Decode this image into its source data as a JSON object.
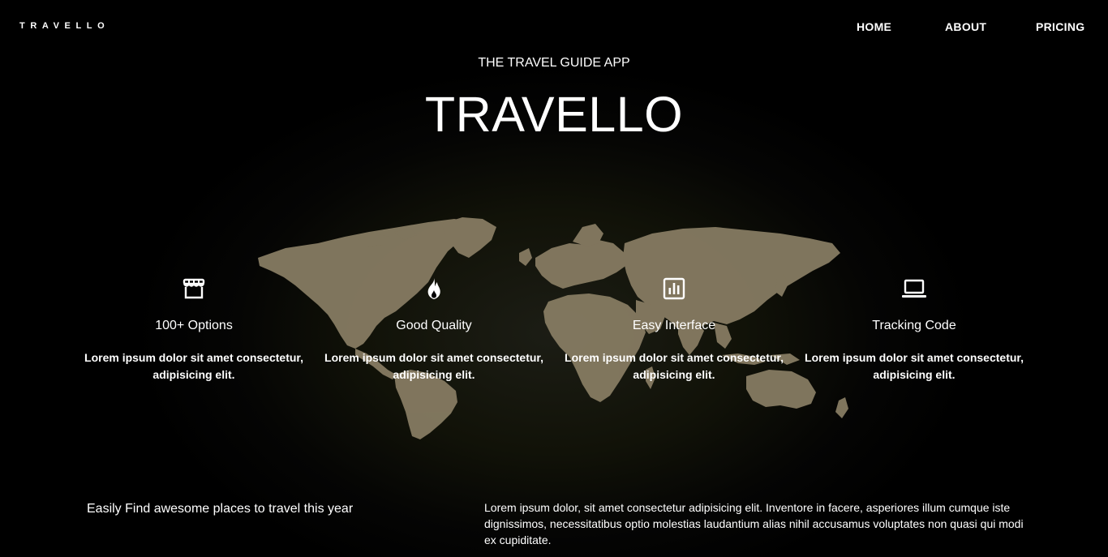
{
  "brand": "TRAVELLO",
  "nav": [
    {
      "label": "HOME"
    },
    {
      "label": "ABOUT"
    },
    {
      "label": "PRICING"
    }
  ],
  "hero": {
    "kicker": "THE TRAVEL GUIDE APP",
    "title": "TRAVELLO"
  },
  "features": [
    {
      "icon": "storefront-icon",
      "title": "100+ Options",
      "description": "Lorem ipsum dolor sit amet consectetur, adipisicing elit."
    },
    {
      "icon": "flame-icon",
      "title": "Good Quality",
      "description": "Lorem ipsum dolor sit amet consectetur, adipisicing elit."
    },
    {
      "icon": "bar-chart-icon",
      "title": "Easy Interface",
      "description": "Lorem ipsum dolor sit amet consectetur, adipisicing elit."
    },
    {
      "icon": "laptop-icon",
      "title": "Tracking Code",
      "description": "Lorem ipsum dolor sit amet consectetur, adipisicing elit."
    }
  ],
  "intro": {
    "tagline": "Easily Find awesome places to travel this year",
    "paragraph": "Lorem ipsum dolor, sit amet consectetur adipisicing elit. Inventore in facere, asperiores illum cumque iste dignissimos, necessitatibus optio molestias laudantium alias nihil accusamus voluptates non quasi qui modi ex cupiditate."
  },
  "colors": {
    "background": "#000000",
    "map_land": "#8a7f66",
    "text": "#ffffff"
  }
}
